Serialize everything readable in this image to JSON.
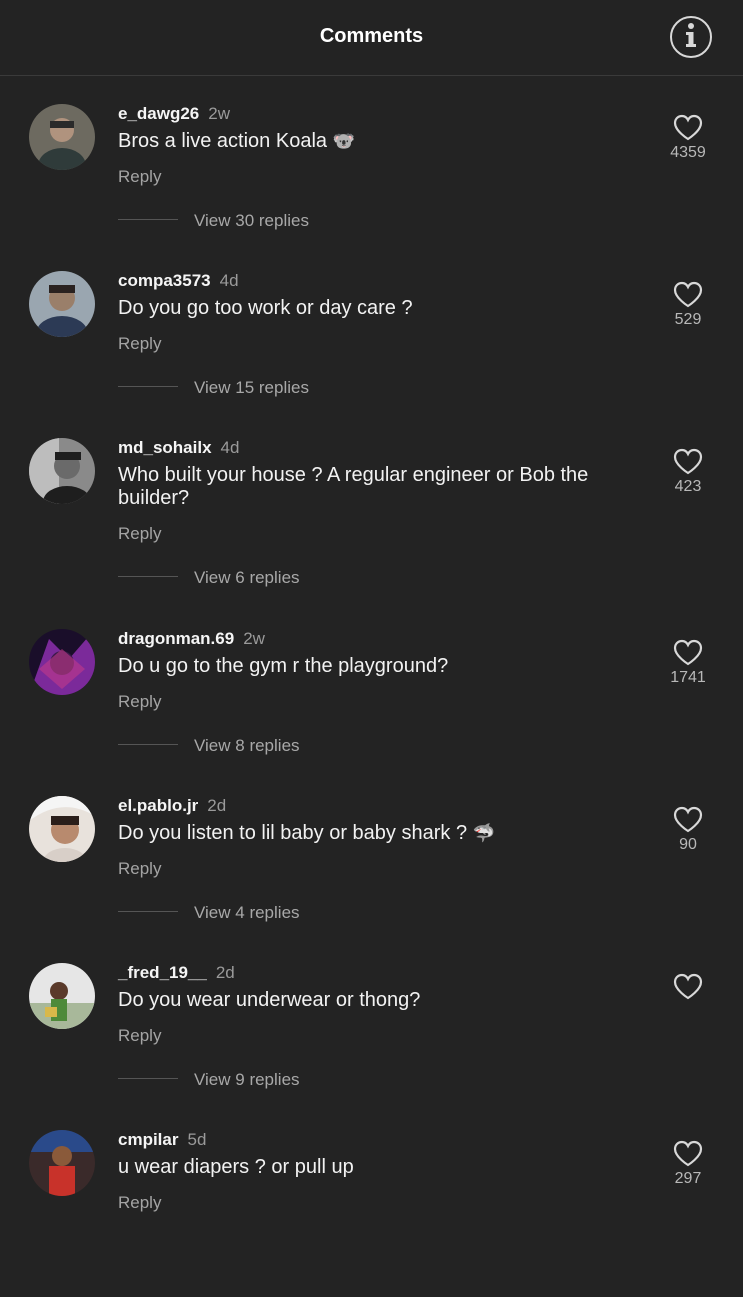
{
  "header": {
    "title": "Comments",
    "info_icon": "info-icon"
  },
  "comments": [
    {
      "username": "e_dawg26",
      "time": "2w",
      "text": "Bros a live action Koala",
      "emoji": "🐨",
      "reply": "Reply",
      "view_replies": "View 30 replies",
      "likes": "4359",
      "avatar_colors": [
        "#6d6a60",
        "#2f3b3a"
      ]
    },
    {
      "username": "compa3573",
      "time": "4d",
      "text": "Do you go too work or day care ?",
      "emoji": "",
      "reply": "Reply",
      "view_replies": "View 15 replies",
      "likes": "529",
      "avatar_colors": [
        "#9a7f6a",
        "#2c3a55"
      ]
    },
    {
      "username": "md_sohailx",
      "time": "4d",
      "text": "Who built your house ? A regular engineer or Bob the builder?",
      "emoji": "",
      "reply": "Reply",
      "view_replies": "View 6 replies",
      "likes": "423",
      "avatar_colors": [
        "#8a8a8a",
        "#1e1e1e"
      ]
    },
    {
      "username": "dragonman.69",
      "time": "2w",
      "text": "Do u go to the gym r the playground?",
      "emoji": "",
      "reply": "Reply",
      "view_replies": "View 8 replies",
      "likes": "1741",
      "avatar_colors": [
        "#7b2a9a",
        "#1a0e2a"
      ]
    },
    {
      "username": "el.pablo.jr",
      "time": "2d",
      "text": "Do you listen to lil baby or baby shark ?",
      "emoji": "🦈",
      "reply": "Reply",
      "view_replies": "View 4 replies",
      "likes": "90",
      "avatar_colors": [
        "#e8e2dc",
        "#b88a6e"
      ]
    },
    {
      "username": "_fred_19__",
      "time": "2d",
      "text": "Do you wear underwear or thong?",
      "emoji": "",
      "reply": "Reply",
      "view_replies": "View 9 replies",
      "likes": "",
      "avatar_colors": [
        "#e6e6e6",
        "#4e8a3a"
      ]
    },
    {
      "username": "cmpilar",
      "time": "5d",
      "text": "u wear diapers ? or pull up",
      "emoji": "",
      "reply": "Reply",
      "view_replies": "",
      "likes": "297",
      "avatar_colors": [
        "#3a2a2a",
        "#c8322a"
      ]
    }
  ]
}
